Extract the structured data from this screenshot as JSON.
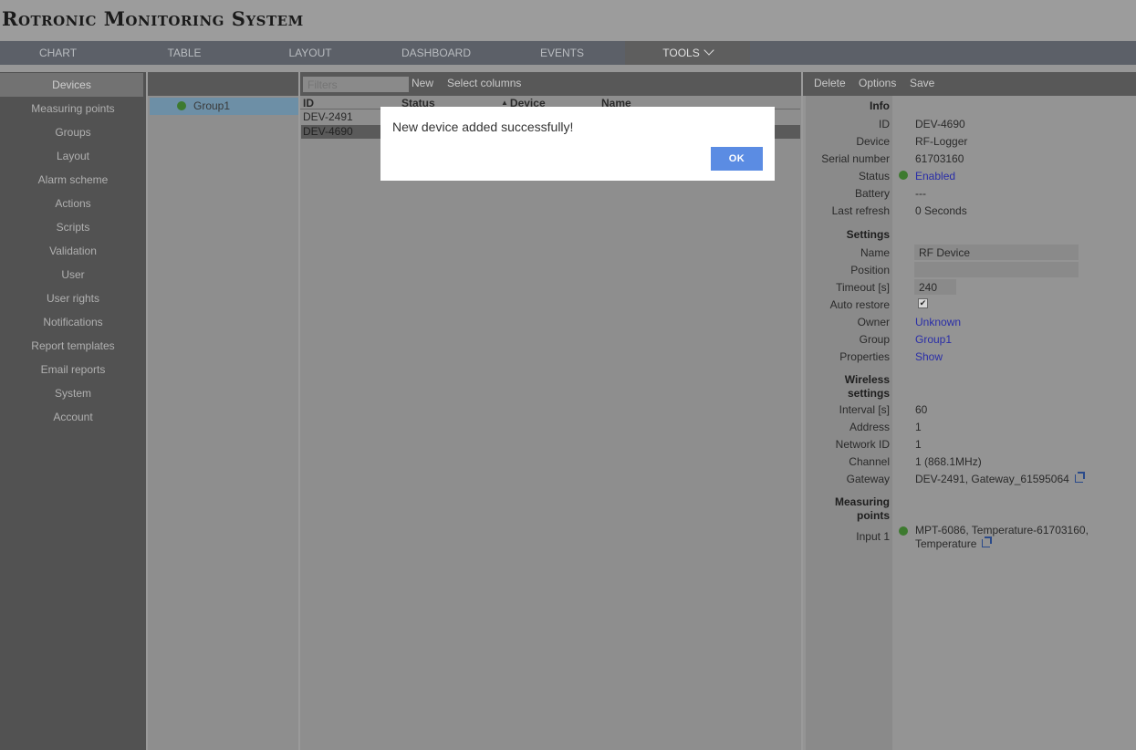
{
  "app": {
    "title": "Rotronic Monitoring System"
  },
  "topnav": {
    "tabs": [
      {
        "label": "CHART"
      },
      {
        "label": "TABLE"
      },
      {
        "label": "LAYOUT"
      },
      {
        "label": "DASHBOARD"
      },
      {
        "label": "EVENTS"
      },
      {
        "label": "TOOLS",
        "active": true
      }
    ]
  },
  "sidebar": {
    "items": [
      {
        "label": "Devices"
      },
      {
        "label": "Measuring points"
      },
      {
        "label": "Groups"
      },
      {
        "label": "Layout"
      },
      {
        "label": "Alarm scheme"
      },
      {
        "label": "Actions"
      },
      {
        "label": "Scripts"
      },
      {
        "label": "Validation"
      },
      {
        "label": "User"
      },
      {
        "label": "User rights"
      },
      {
        "label": "Notifications"
      },
      {
        "label": "Report templates"
      },
      {
        "label": "Email reports"
      },
      {
        "label": "System"
      },
      {
        "label": "Account"
      }
    ]
  },
  "groups": {
    "items": [
      {
        "label": "Group1"
      }
    ]
  },
  "device_list": {
    "filter_placeholder": "Filters",
    "new_label": "New",
    "select_columns_label": "Select columns",
    "columns": [
      "ID",
      "Status",
      "Device",
      "Name"
    ],
    "sort_arrow": "▲",
    "rows": [
      {
        "id": "DEV-2491"
      },
      {
        "id": "DEV-4690"
      }
    ]
  },
  "details": {
    "toolbar": {
      "delete": "Delete",
      "options": "Options",
      "save": "Save"
    },
    "info": {
      "section": "Info",
      "id_label": "ID",
      "id": "DEV-4690",
      "device_label": "Device",
      "device": "RF-Logger",
      "serial_label": "Serial number",
      "serial": "61703160",
      "status_label": "Status",
      "status": "Enabled",
      "battery_label": "Battery",
      "battery": "---",
      "refresh_label": "Last refresh",
      "refresh": "0 Seconds"
    },
    "settings": {
      "section": "Settings",
      "name_label": "Name",
      "name": "RF Device",
      "position_label": "Position",
      "position": "",
      "timeout_label": "Timeout [s]",
      "timeout": "240",
      "autorestore_label": "Auto restore",
      "autorestore_check": "✔",
      "owner_label": "Owner",
      "owner": "Unknown",
      "group_label": "Group",
      "group": "Group1",
      "properties_label": "Properties",
      "properties": "Show"
    },
    "wireless": {
      "section_1": "Wireless",
      "section_2": "settings",
      "interval_label": "Interval [s]",
      "interval": "60",
      "address_label": "Address",
      "address": "1",
      "network_label": "Network ID",
      "network": "1",
      "channel_label": "Channel",
      "channel": "1 (868.1MHz)",
      "gateway_label": "Gateway",
      "gateway": "DEV-2491, Gateway_61595064"
    },
    "measuring": {
      "section_1": "Measuring",
      "section_2": "points",
      "input_label": "Input 1",
      "input_line1": "MPT-6086, Temperature-61703160,",
      "input_line2": "Temperature"
    }
  },
  "modal": {
    "message": "New device added successfully!",
    "ok": "OK"
  },
  "colors": {
    "accent": "#5b8ce3",
    "status_green": "#3d7a2f",
    "link": "#2a2ea8"
  }
}
